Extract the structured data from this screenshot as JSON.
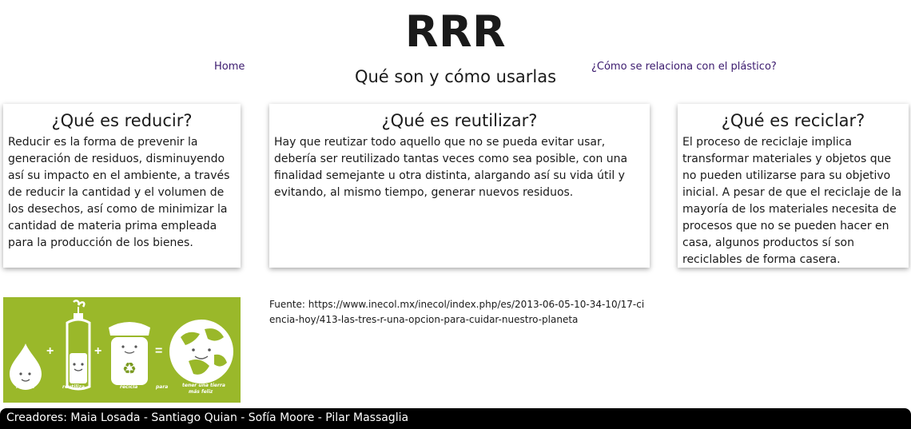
{
  "header": {
    "title": "RRR",
    "subtitle": "Qué son y cómo usarlas"
  },
  "nav": {
    "home": "Home",
    "plastic": "¿Cómo se relaciona con el plástico?"
  },
  "cards": [
    {
      "title": "¿Qué es reducir?",
      "body": "Reducir es la forma de prevenir la generación de residuos, disminuyendo así su impacto en el ambiente, a través de reducir la cantidad y el volumen de los desechos, así como de minimizar la cantidad de materia prima empleada para la producción de los bienes."
    },
    {
      "title": "¿Qué es reutilizar?",
      "body": "Hay que reutizar todo aquello que no se pueda evitar usar, debería ser reutilizado tantas veces como sea posible, con una finalidad semejante u otra distinta, alargando así su vida útil y evitando, al mismo tiempo, generar nuevos residuos."
    },
    {
      "title": "¿Qué es reciclar?",
      "body": "El proceso de reciclaje implica transformar materiales y objetos que no pueden utilizarse para su objetivo inicial. A pesar de que el reciclaje de la mayoría de los materiales necesita de procesos que no se pueden hacer en casa, algunos productos sí son reciclables de forma casera."
    }
  ],
  "image": {
    "labels": [
      "reduce",
      "reutiliza",
      "recicla",
      "para",
      "tener una tierra",
      "más feliz"
    ],
    "ops": [
      "+",
      "+",
      "="
    ],
    "bg_color": "#9ab82a"
  },
  "source": "Fuente: https://www.inecol.mx/inecol/index.php/es/2013-06-05-10-34-10/17-ciencia-hoy/413-las-tres-r-una-opcion-para-cuidar-nuestro-planeta",
  "footer": {
    "credits": "Creadores: Maia Losada - Santiago Quian - Sofía Moore - Pilar Massaglia"
  }
}
